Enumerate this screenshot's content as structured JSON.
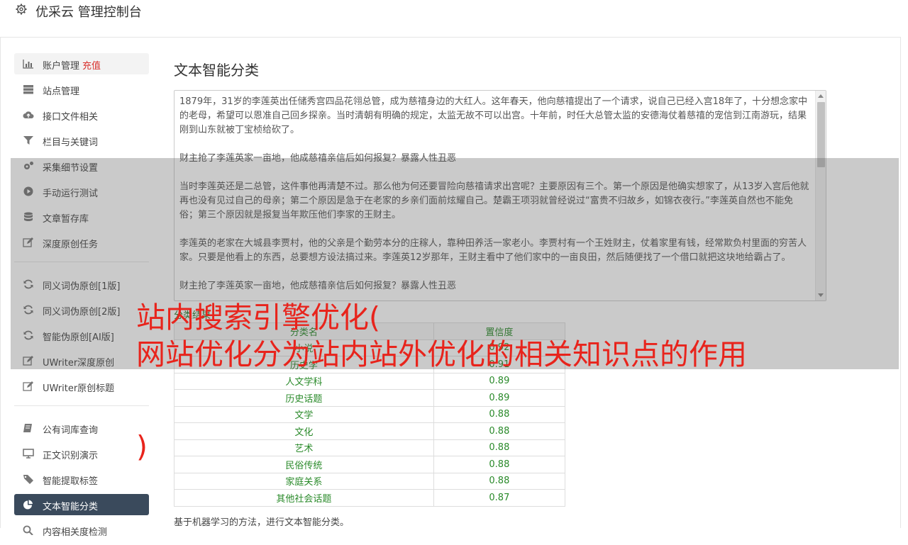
{
  "app": {
    "title": "优采云 管理控制台"
  },
  "sidebar": {
    "group1": [
      {
        "label": "账户管理",
        "badge": "充值",
        "icon": "bar-chart-icon"
      },
      {
        "label": "站点管理",
        "icon": "server-icon"
      },
      {
        "label": "接口文件相关",
        "icon": "cloud-upload-icon"
      },
      {
        "label": "栏目与关键词",
        "icon": "filter-icon"
      },
      {
        "label": "采集细节设置",
        "icon": "cogs-icon"
      },
      {
        "label": "手动运行测试",
        "icon": "play-circle-icon"
      },
      {
        "label": "文章暂存库",
        "icon": "database-icon"
      },
      {
        "label": "深度原创任务",
        "icon": "edit-icon"
      }
    ],
    "group2": [
      {
        "label": "同义词伪原创[1版]",
        "icon": "refresh-icon"
      },
      {
        "label": "同义词伪原创[2版]",
        "icon": "refresh-icon"
      },
      {
        "label": "智能伪原创[AI版]",
        "icon": "refresh-icon"
      },
      {
        "label": "UWriter深度原创",
        "icon": "edit-icon"
      },
      {
        "label": "UWriter原创标题",
        "icon": "edit-icon"
      }
    ],
    "group3": [
      {
        "label": "公有词库查询",
        "icon": "book-icon"
      },
      {
        "label": "正文识别演示",
        "icon": "monitor-icon"
      },
      {
        "label": "智能提取标签",
        "icon": "tag-icon"
      },
      {
        "label": "文本智能分类",
        "icon": "pie-chart-icon"
      },
      {
        "label": "内容相关度检测",
        "icon": "search-icon"
      }
    ]
  },
  "main": {
    "title": "文本智能分类",
    "text_paragraphs": [
      "1879年，31岁的李莲英出任储秀宫四品花翎总管，成为慈禧身边的大红人。这年春天，他向慈禧提出了一个请求，说自己已经入宫18年了，十分想念家中的老母，希望可以恩准自己回乡探亲。当时清朝有明确的规定，太监无故不可以出宫。十年前，时任大总管太监的安德海仗着慈禧的宠信到江南游玩，结果刚到山东就被丁宝桢给砍了。",
      "财主抢了李莲英家一亩地，他成慈禧亲信后如何报复？暴露人性丑恶",
      "当时李莲英还是二总管，这件事他再清楚不过。那么他为何还要冒险向慈禧请求出宫呢？主要原因有三个。第一个原因是他确实想家了，从13岁入宫后他就再也没有见过自己的母亲；第二个原因是急于在老家的乡亲们面前炫耀自己。楚霸王项羽就曾经说过“富贵不归故乡，如锦衣夜行。”李莲英自然也不能免俗；第三个原因就是报复当年欺压他们李家的王财主。",
      "李莲英的老家在大城县李贾村，他的父亲是个勤劳本分的庄稼人，靠种田养活一家老小。李贾村有一个王姓财主，仗着家里有钱，经常欺负村里面的穷苦人家。只要是他看上的东西，总要想方设法搞过来。李莲英12岁那年，王财主看中了他们家中的一亩良田，然后随便找了一个借口就把这块地给霸占了。",
      "财主抢了李莲英家一亩地，他成慈禧亲信后如何报复？暴露人性丑恶"
    ],
    "result_label": "分类结果：",
    "table": {
      "headers": [
        "分类名",
        "置信度"
      ],
      "rows": [
        [
          "小说",
          "0.92"
        ],
        [
          "历史学",
          "0.91"
        ],
        [
          "人文学科",
          "0.89"
        ],
        [
          "历史话题",
          "0.89"
        ],
        [
          "文学",
          "0.88"
        ],
        [
          "文化",
          "0.88"
        ],
        [
          "艺术",
          "0.88"
        ],
        [
          "民俗传统",
          "0.88"
        ],
        [
          "家庭关系",
          "0.88"
        ],
        [
          "其他社会话题",
          "0.87"
        ]
      ]
    },
    "footnote": "基于机器学习的方法，进行文本智能分类。"
  },
  "overlay": {
    "line1": "站内搜索引擎优化(",
    "line2": "网站优化分为站内站外优化的相关知识点的作用",
    "line3": ")"
  },
  "colors": {
    "accent_red": "#e8241c",
    "active_nav": "#3a4a5c",
    "result_green": "#2a8a2a"
  }
}
